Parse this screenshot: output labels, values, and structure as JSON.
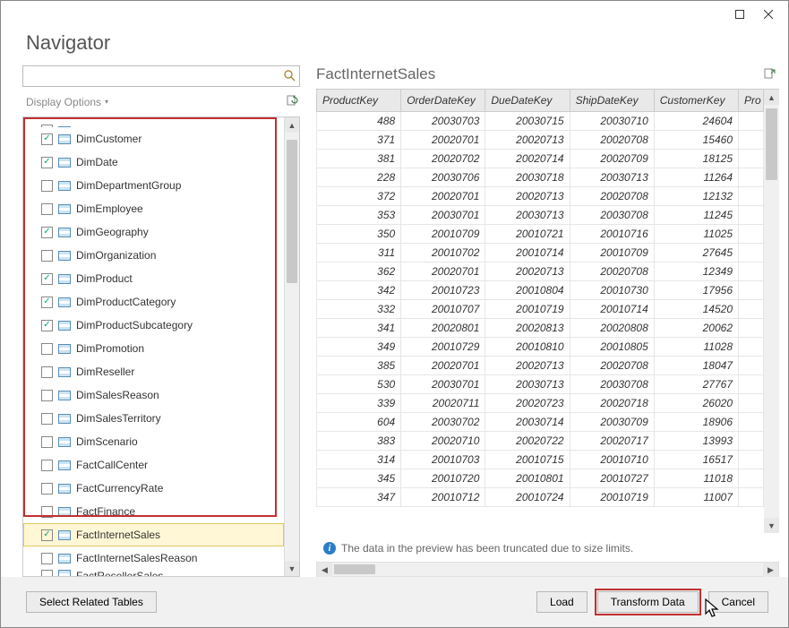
{
  "title": "Navigator",
  "search": {
    "placeholder": ""
  },
  "displayOptions": {
    "label": "Display Options"
  },
  "tree": {
    "items": [
      {
        "name": "DimCustomer",
        "checked": true
      },
      {
        "name": "DimDate",
        "checked": true
      },
      {
        "name": "DimDepartmentGroup",
        "checked": false
      },
      {
        "name": "DimEmployee",
        "checked": false
      },
      {
        "name": "DimGeography",
        "checked": true
      },
      {
        "name": "DimOrganization",
        "checked": false
      },
      {
        "name": "DimProduct",
        "checked": true
      },
      {
        "name": "DimProductCategory",
        "checked": true
      },
      {
        "name": "DimProductSubcategory",
        "checked": true
      },
      {
        "name": "DimPromotion",
        "checked": false
      },
      {
        "name": "DimReseller",
        "checked": false
      },
      {
        "name": "DimSalesReason",
        "checked": false
      },
      {
        "name": "DimSalesTerritory",
        "checked": false
      },
      {
        "name": "DimScenario",
        "checked": false
      },
      {
        "name": "FactCallCenter",
        "checked": false
      },
      {
        "name": "FactCurrencyRate",
        "checked": false
      },
      {
        "name": "FactFinance",
        "checked": false
      },
      {
        "name": "FactInternetSales",
        "checked": true,
        "selected": true
      },
      {
        "name": "FactInternetSalesReason",
        "checked": false
      },
      {
        "name": "FactResellerSales",
        "checked": false
      }
    ],
    "topClipped": {
      "name": "",
      "checked": false
    }
  },
  "preview": {
    "title": "FactInternetSales",
    "columns": [
      "ProductKey",
      "OrderDateKey",
      "DueDateKey",
      "ShipDateKey",
      "CustomerKey",
      "Pro"
    ],
    "rows": [
      [
        "488",
        "20030703",
        "20030715",
        "20030710",
        "24604"
      ],
      [
        "371",
        "20020701",
        "20020713",
        "20020708",
        "15460"
      ],
      [
        "381",
        "20020702",
        "20020714",
        "20020709",
        "18125"
      ],
      [
        "228",
        "20030706",
        "20030718",
        "20030713",
        "11264"
      ],
      [
        "372",
        "20020701",
        "20020713",
        "20020708",
        "12132"
      ],
      [
        "353",
        "20030701",
        "20030713",
        "20030708",
        "11245"
      ],
      [
        "350",
        "20010709",
        "20010721",
        "20010716",
        "11025"
      ],
      [
        "311",
        "20010702",
        "20010714",
        "20010709",
        "27645"
      ],
      [
        "362",
        "20020701",
        "20020713",
        "20020708",
        "12349"
      ],
      [
        "342",
        "20010723",
        "20010804",
        "20010730",
        "17956"
      ],
      [
        "332",
        "20010707",
        "20010719",
        "20010714",
        "14520"
      ],
      [
        "341",
        "20020801",
        "20020813",
        "20020808",
        "20062"
      ],
      [
        "349",
        "20010729",
        "20010810",
        "20010805",
        "11028"
      ],
      [
        "385",
        "20020701",
        "20020713",
        "20020708",
        "18047"
      ],
      [
        "530",
        "20030701",
        "20030713",
        "20030708",
        "27767"
      ],
      [
        "339",
        "20020711",
        "20020723",
        "20020718",
        "26020"
      ],
      [
        "604",
        "20030702",
        "20030714",
        "20030709",
        "18906"
      ],
      [
        "383",
        "20020710",
        "20020722",
        "20020717",
        "13993"
      ],
      [
        "314",
        "20010703",
        "20010715",
        "20010710",
        "16517"
      ],
      [
        "345",
        "20010720",
        "20010801",
        "20010727",
        "11018"
      ],
      [
        "347",
        "20010712",
        "20010724",
        "20010719",
        "11007"
      ]
    ],
    "truncMsg": "The data in the preview has been truncated due to size limits."
  },
  "footer": {
    "selectRelated": "Select Related Tables",
    "load": "Load",
    "transform": "Transform Data",
    "cancel": "Cancel"
  }
}
